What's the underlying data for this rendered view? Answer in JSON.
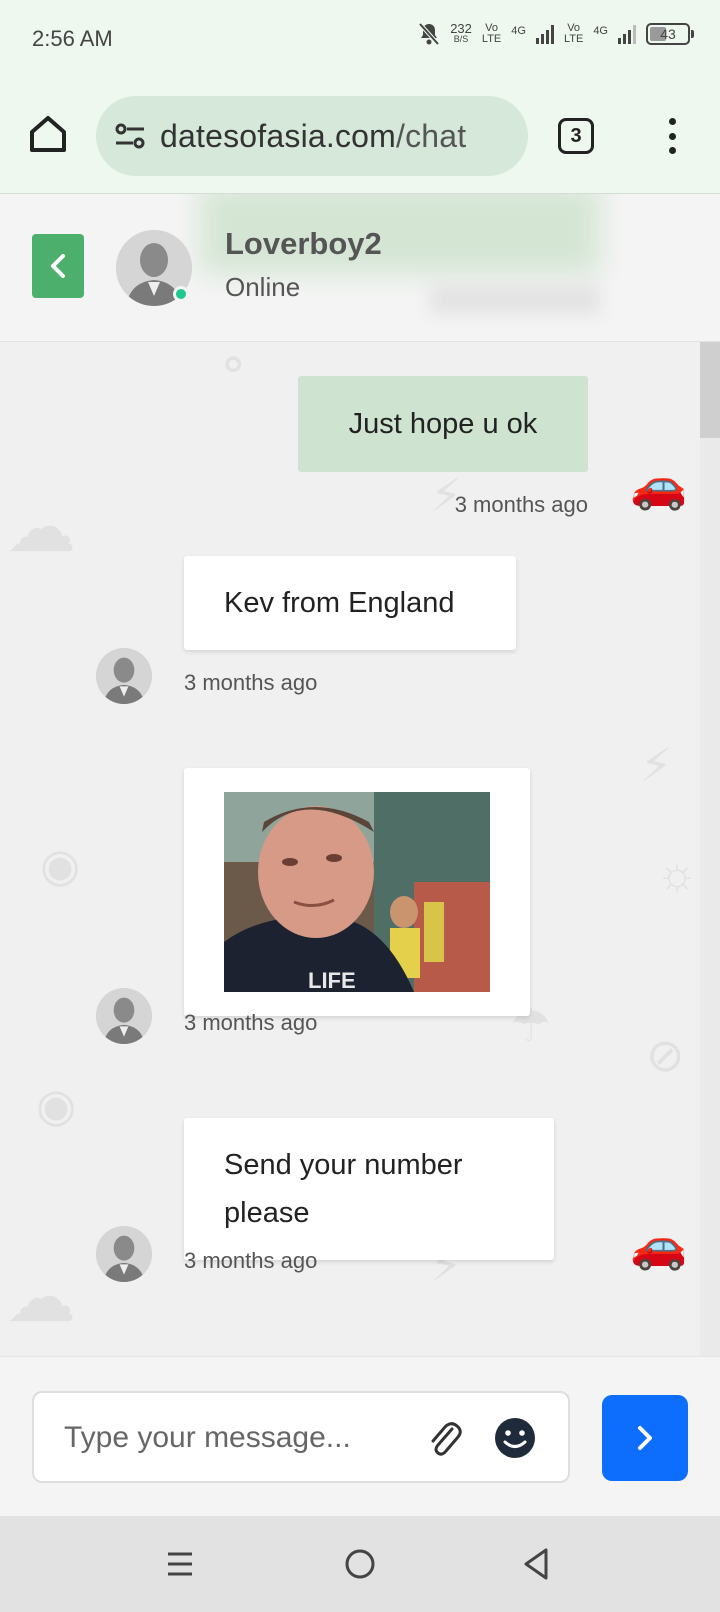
{
  "status_bar": {
    "time": "2:56 AM",
    "net_speed_value": "232",
    "net_speed_unit": "B/S",
    "volte1": "Vo\nLTE",
    "net1": "4G",
    "volte2": "Vo\nLTE",
    "net2": "4G",
    "battery_level": "43",
    "icons": [
      "mute-bell-icon",
      "signal-icon",
      "battery-icon"
    ]
  },
  "browser": {
    "url_domain": "datesofasia.com",
    "url_path": "/chat",
    "tab_count": "3",
    "icons": [
      "home-icon",
      "site-settings-icon",
      "overflow-menu-icon"
    ]
  },
  "chat_header": {
    "contact_name": "Loverboy2",
    "contact_status": "Online",
    "accent_color": "#4caf6c",
    "online_color": "#1ec98f"
  },
  "messages": [
    {
      "direction": "out",
      "text": "Just hope u ok",
      "time": "3 months ago"
    },
    {
      "direction": "in",
      "text": "Kev from England",
      "time": "3 months ago"
    },
    {
      "direction": "in",
      "type": "image",
      "time": "3 months ago"
    },
    {
      "direction": "in",
      "text": "Send your number please",
      "time": "3 months ago"
    }
  ],
  "composer": {
    "placeholder": "Type your message...",
    "send_color": "#0d6efd",
    "icons": [
      "paperclip-icon",
      "emoji-icon",
      "chevron-right-icon"
    ]
  },
  "nav": {
    "icons": [
      "recents-icon",
      "home-circle-icon",
      "back-triangle-icon"
    ]
  }
}
